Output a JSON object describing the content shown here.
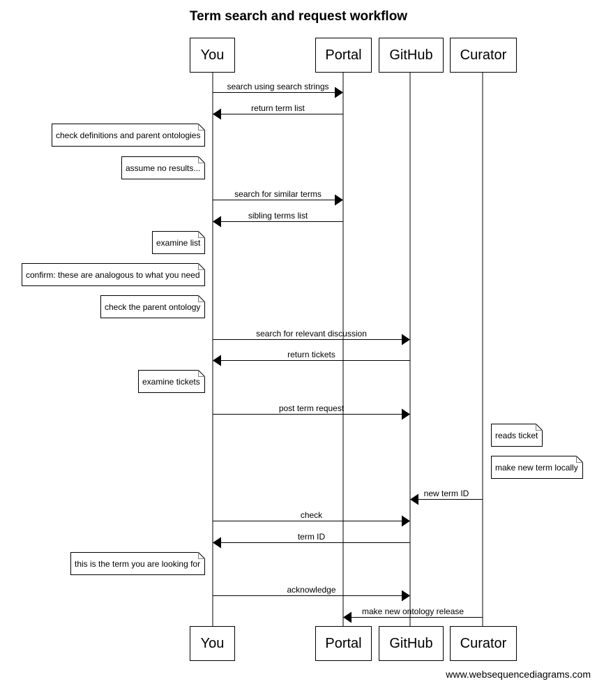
{
  "title": "Term search and request workflow",
  "footer": "www.websequencediagrams.com",
  "colors": {
    "stroke": "#000000",
    "background": "#ffffff",
    "note_fold": "#808080"
  },
  "participants": [
    {
      "id": "you",
      "label": "You"
    },
    {
      "id": "portal",
      "label": "Portal"
    },
    {
      "id": "github",
      "label": "GitHub"
    },
    {
      "id": "curator",
      "label": "Curator"
    }
  ],
  "steps": [
    {
      "type": "message",
      "from": "you",
      "to": "portal",
      "label": "search using search strings"
    },
    {
      "type": "message",
      "from": "portal",
      "to": "you",
      "label": "return term list"
    },
    {
      "type": "note",
      "side": "left",
      "of": "you",
      "label": "check definitions and parent ontologies"
    },
    {
      "type": "note",
      "side": "left",
      "of": "you",
      "label": "assume no results..."
    },
    {
      "type": "message",
      "from": "you",
      "to": "portal",
      "label": "search for similar terms"
    },
    {
      "type": "message",
      "from": "portal",
      "to": "you",
      "label": "sibling terms list"
    },
    {
      "type": "note",
      "side": "left",
      "of": "you",
      "label": "examine list"
    },
    {
      "type": "note",
      "side": "left",
      "of": "you",
      "label": "confirm: these are analogous to what you need"
    },
    {
      "type": "note",
      "side": "left",
      "of": "you",
      "label": "check the parent ontology"
    },
    {
      "type": "message",
      "from": "you",
      "to": "github",
      "label": "search for relevant discussion"
    },
    {
      "type": "message",
      "from": "github",
      "to": "you",
      "label": "return tickets"
    },
    {
      "type": "note",
      "side": "left",
      "of": "you",
      "label": "examine tickets"
    },
    {
      "type": "message",
      "from": "you",
      "to": "github",
      "label": "post term request"
    },
    {
      "type": "note",
      "side": "right",
      "of": "curator",
      "label": "reads ticket"
    },
    {
      "type": "note",
      "side": "right",
      "of": "curator",
      "label": "make new term locally"
    },
    {
      "type": "message",
      "from": "curator",
      "to": "github",
      "label": "new term ID"
    },
    {
      "type": "message",
      "from": "you",
      "to": "github",
      "label": "check"
    },
    {
      "type": "message",
      "from": "github",
      "to": "you",
      "label": "term ID"
    },
    {
      "type": "note",
      "side": "left",
      "of": "you",
      "label": "this is the term you are looking for"
    },
    {
      "type": "message",
      "from": "you",
      "to": "github",
      "label": "acknowledge"
    },
    {
      "type": "message",
      "from": "curator",
      "to": "portal",
      "label": "make new ontology release"
    }
  ]
}
